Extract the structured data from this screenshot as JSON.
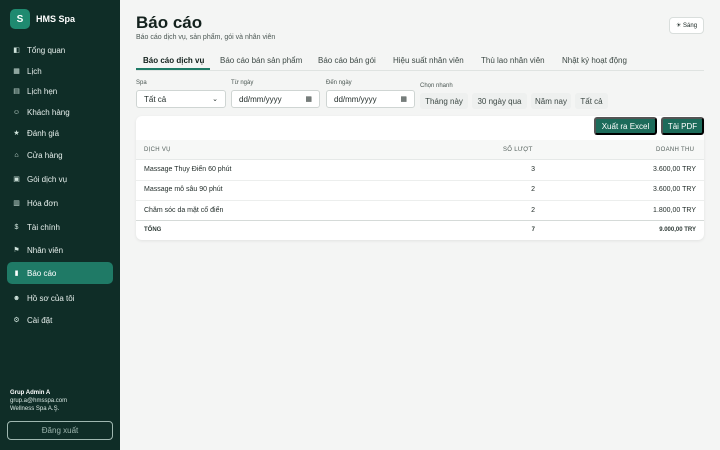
{
  "sidebar": {
    "brand_logo": "S",
    "brand_name": "HMS Spa",
    "items": [
      {
        "icon": "◧",
        "label": "Tổng quan"
      },
      {
        "icon": "▦",
        "label": "Lịch"
      },
      {
        "icon": "▤",
        "label": "Lịch hẹn"
      },
      {
        "icon": "☺",
        "label": "Khách hàng"
      },
      {
        "icon": "★",
        "label": "Đánh giá"
      },
      {
        "icon": "⌂",
        "label": "Cửa hàng"
      },
      {
        "icon": "▣",
        "label": "Gói dịch vụ"
      },
      {
        "icon": "▥",
        "label": "Hóa đơn"
      },
      {
        "icon": "$",
        "label": "Tài chính"
      },
      {
        "icon": "⚑",
        "label": "Nhân viên"
      },
      {
        "icon": "▮",
        "label": "Báo cáo"
      },
      {
        "icon": "☻",
        "label": "Hồ sơ của tôi"
      },
      {
        "icon": "⚙",
        "label": "Cài đặt"
      }
    ],
    "user_name": "Grup Admin A",
    "user_email": "grup.a@hmsspa.com",
    "user_company": "Wellness Spa A.Ş.",
    "logout_label": "Đăng xuất"
  },
  "header": {
    "title": "Báo cáo",
    "subtitle": "Báo cáo dịch vụ, sản phẩm, gói và nhân viên",
    "theme_label": "☀ Sáng"
  },
  "tabs": [
    "Báo cáo dịch vụ",
    "Báo cáo bán sản phẩm",
    "Báo cáo bán gói",
    "Hiệu suất nhân viên",
    "Thù lao nhân viên",
    "Nhật ký hoạt động"
  ],
  "filters": {
    "spa_label": "Spa",
    "spa_value": "Tất cả",
    "from_label": "Từ ngày",
    "from_placeholder": "dd/mm/yyyy",
    "to_label": "Đến ngày",
    "to_placeholder": "dd/mm/yyyy",
    "quick_label": "Chọn nhanh",
    "quick_options": [
      "Tháng này",
      "30 ngày qua",
      "Năm nay",
      "Tất cả"
    ]
  },
  "actions": {
    "excel_label": "Xuất ra Excel",
    "pdf_label": "Tải PDF"
  },
  "table": {
    "headers": [
      "DỊCH VỤ",
      "SỐ LƯỢT",
      "DOANH THU"
    ],
    "rows": [
      {
        "service": "Massage Thụy Điển 60 phút",
        "count": "3",
        "revenue": "3.600,00 TRY"
      },
      {
        "service": "Massage mô sâu 90 phút",
        "count": "2",
        "revenue": "3.600,00 TRY"
      },
      {
        "service": "Chăm sóc da mặt cổ điển",
        "count": "2",
        "revenue": "1.800,00 TRY"
      }
    ],
    "footer": {
      "label": "TỔNG",
      "count": "7",
      "revenue": "9.000,00 TRY"
    }
  },
  "colors": {
    "sidebar": "#0f2d27",
    "accent": "#1f7a66",
    "button": "#1c6b5a"
  }
}
